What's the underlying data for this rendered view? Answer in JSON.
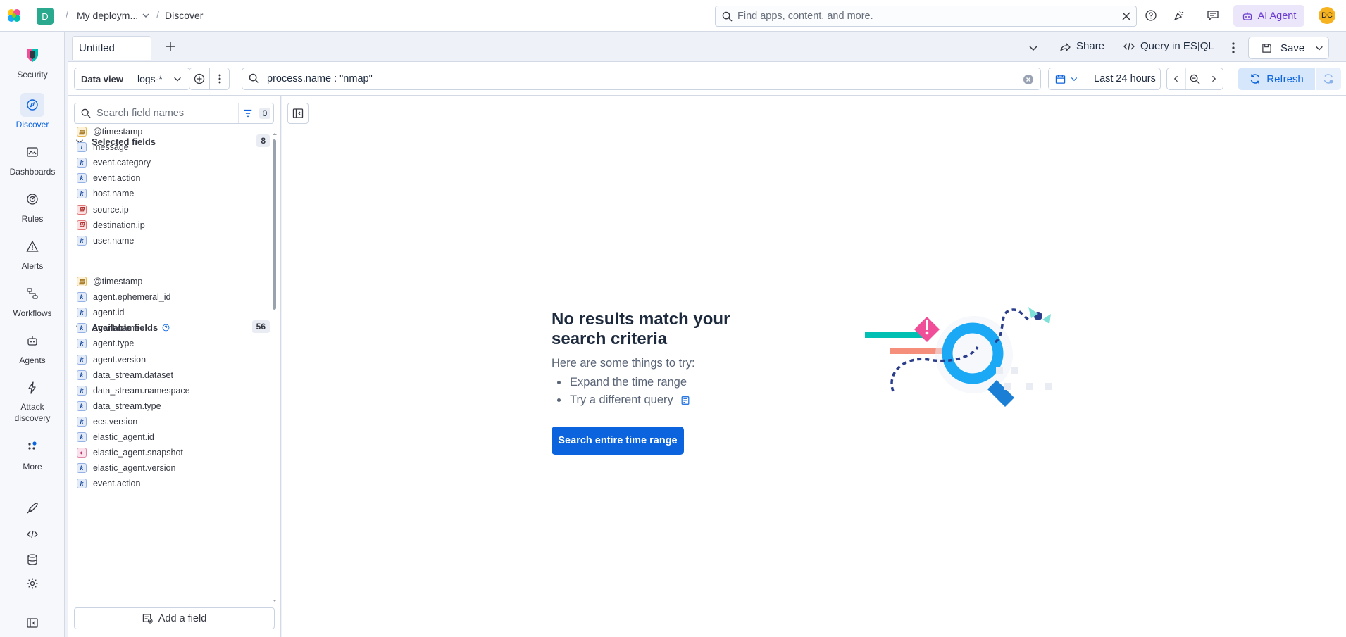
{
  "header": {
    "space_initial": "D",
    "breadcrumb_deployment": "My deploym...",
    "breadcrumb_current": "Discover",
    "search_placeholder": "Find apps, content, and more.",
    "ai_agent_label": "AI Agent",
    "avatar_initials": "DC"
  },
  "nav": {
    "items": [
      {
        "label": "Security",
        "icon": "security-logo-icon"
      },
      {
        "label": "Discover",
        "icon": "compass-icon"
      },
      {
        "label": "Dashboards",
        "icon": "dashboard-icon"
      },
      {
        "label": "Rules",
        "icon": "rules-icon"
      },
      {
        "label": "Alerts",
        "icon": "alert-triangle-icon"
      },
      {
        "label": "Workflows",
        "icon": "workflows-icon"
      },
      {
        "label": "Agents",
        "icon": "robot-icon"
      },
      {
        "label": "Attack discovery",
        "icon": "bolt-icon"
      },
      {
        "label": "More",
        "icon": "more-dots-icon"
      }
    ],
    "bottom_icons": [
      "rocket-icon",
      "code-icon",
      "database-icon",
      "gear-icon",
      "collapse-nav-icon"
    ]
  },
  "tabs": {
    "active": "Untitled",
    "share_label": "Share",
    "esql_label": "Query in ES|QL",
    "save_label": "Save"
  },
  "query": {
    "data_view_label": "Data view",
    "data_view_value": "logs-*",
    "query_text": "process.name : \"nmap\"",
    "time_range": "Last 24 hours",
    "refresh_label": "Refresh"
  },
  "sidebar": {
    "search_placeholder": "Search field names",
    "filter_count": "0",
    "selected_title": "Selected fields",
    "selected_count": "8",
    "selected_fields": [
      {
        "name": "@timestamp",
        "type": "date"
      },
      {
        "name": "message",
        "type": "text"
      },
      {
        "name": "event.category",
        "type": "keyword"
      },
      {
        "name": "event.action",
        "type": "keyword"
      },
      {
        "name": "host.name",
        "type": "keyword"
      },
      {
        "name": "source.ip",
        "type": "ip"
      },
      {
        "name": "destination.ip",
        "type": "ip"
      },
      {
        "name": "user.name",
        "type": "keyword"
      }
    ],
    "available_title": "Available fields",
    "available_count": "56",
    "available_fields": [
      {
        "name": "@timestamp",
        "type": "date"
      },
      {
        "name": "agent.ephemeral_id",
        "type": "keyword"
      },
      {
        "name": "agent.id",
        "type": "keyword"
      },
      {
        "name": "agent.name",
        "type": "keyword"
      },
      {
        "name": "agent.type",
        "type": "keyword"
      },
      {
        "name": "agent.version",
        "type": "keyword"
      },
      {
        "name": "data_stream.dataset",
        "type": "keyword"
      },
      {
        "name": "data_stream.namespace",
        "type": "keyword"
      },
      {
        "name": "data_stream.type",
        "type": "keyword"
      },
      {
        "name": "ecs.version",
        "type": "keyword"
      },
      {
        "name": "elastic_agent.id",
        "type": "keyword"
      },
      {
        "name": "elastic_agent.snapshot",
        "type": "boolean"
      },
      {
        "name": "elastic_agent.version",
        "type": "keyword"
      },
      {
        "name": "event.action",
        "type": "keyword"
      }
    ],
    "add_field_label": "Add a field"
  },
  "empty_state": {
    "title": "No results match your search criteria",
    "subtitle": "Here are some things to try:",
    "tips": [
      "Expand the time range",
      "Try a different query"
    ],
    "cta_label": "Search entire time range"
  },
  "colors": {
    "primary": "#0b64dd",
    "ai_accent": "#6b3dd0",
    "avatar": "#f6b31f",
    "space_badge": "#2ba98f"
  }
}
